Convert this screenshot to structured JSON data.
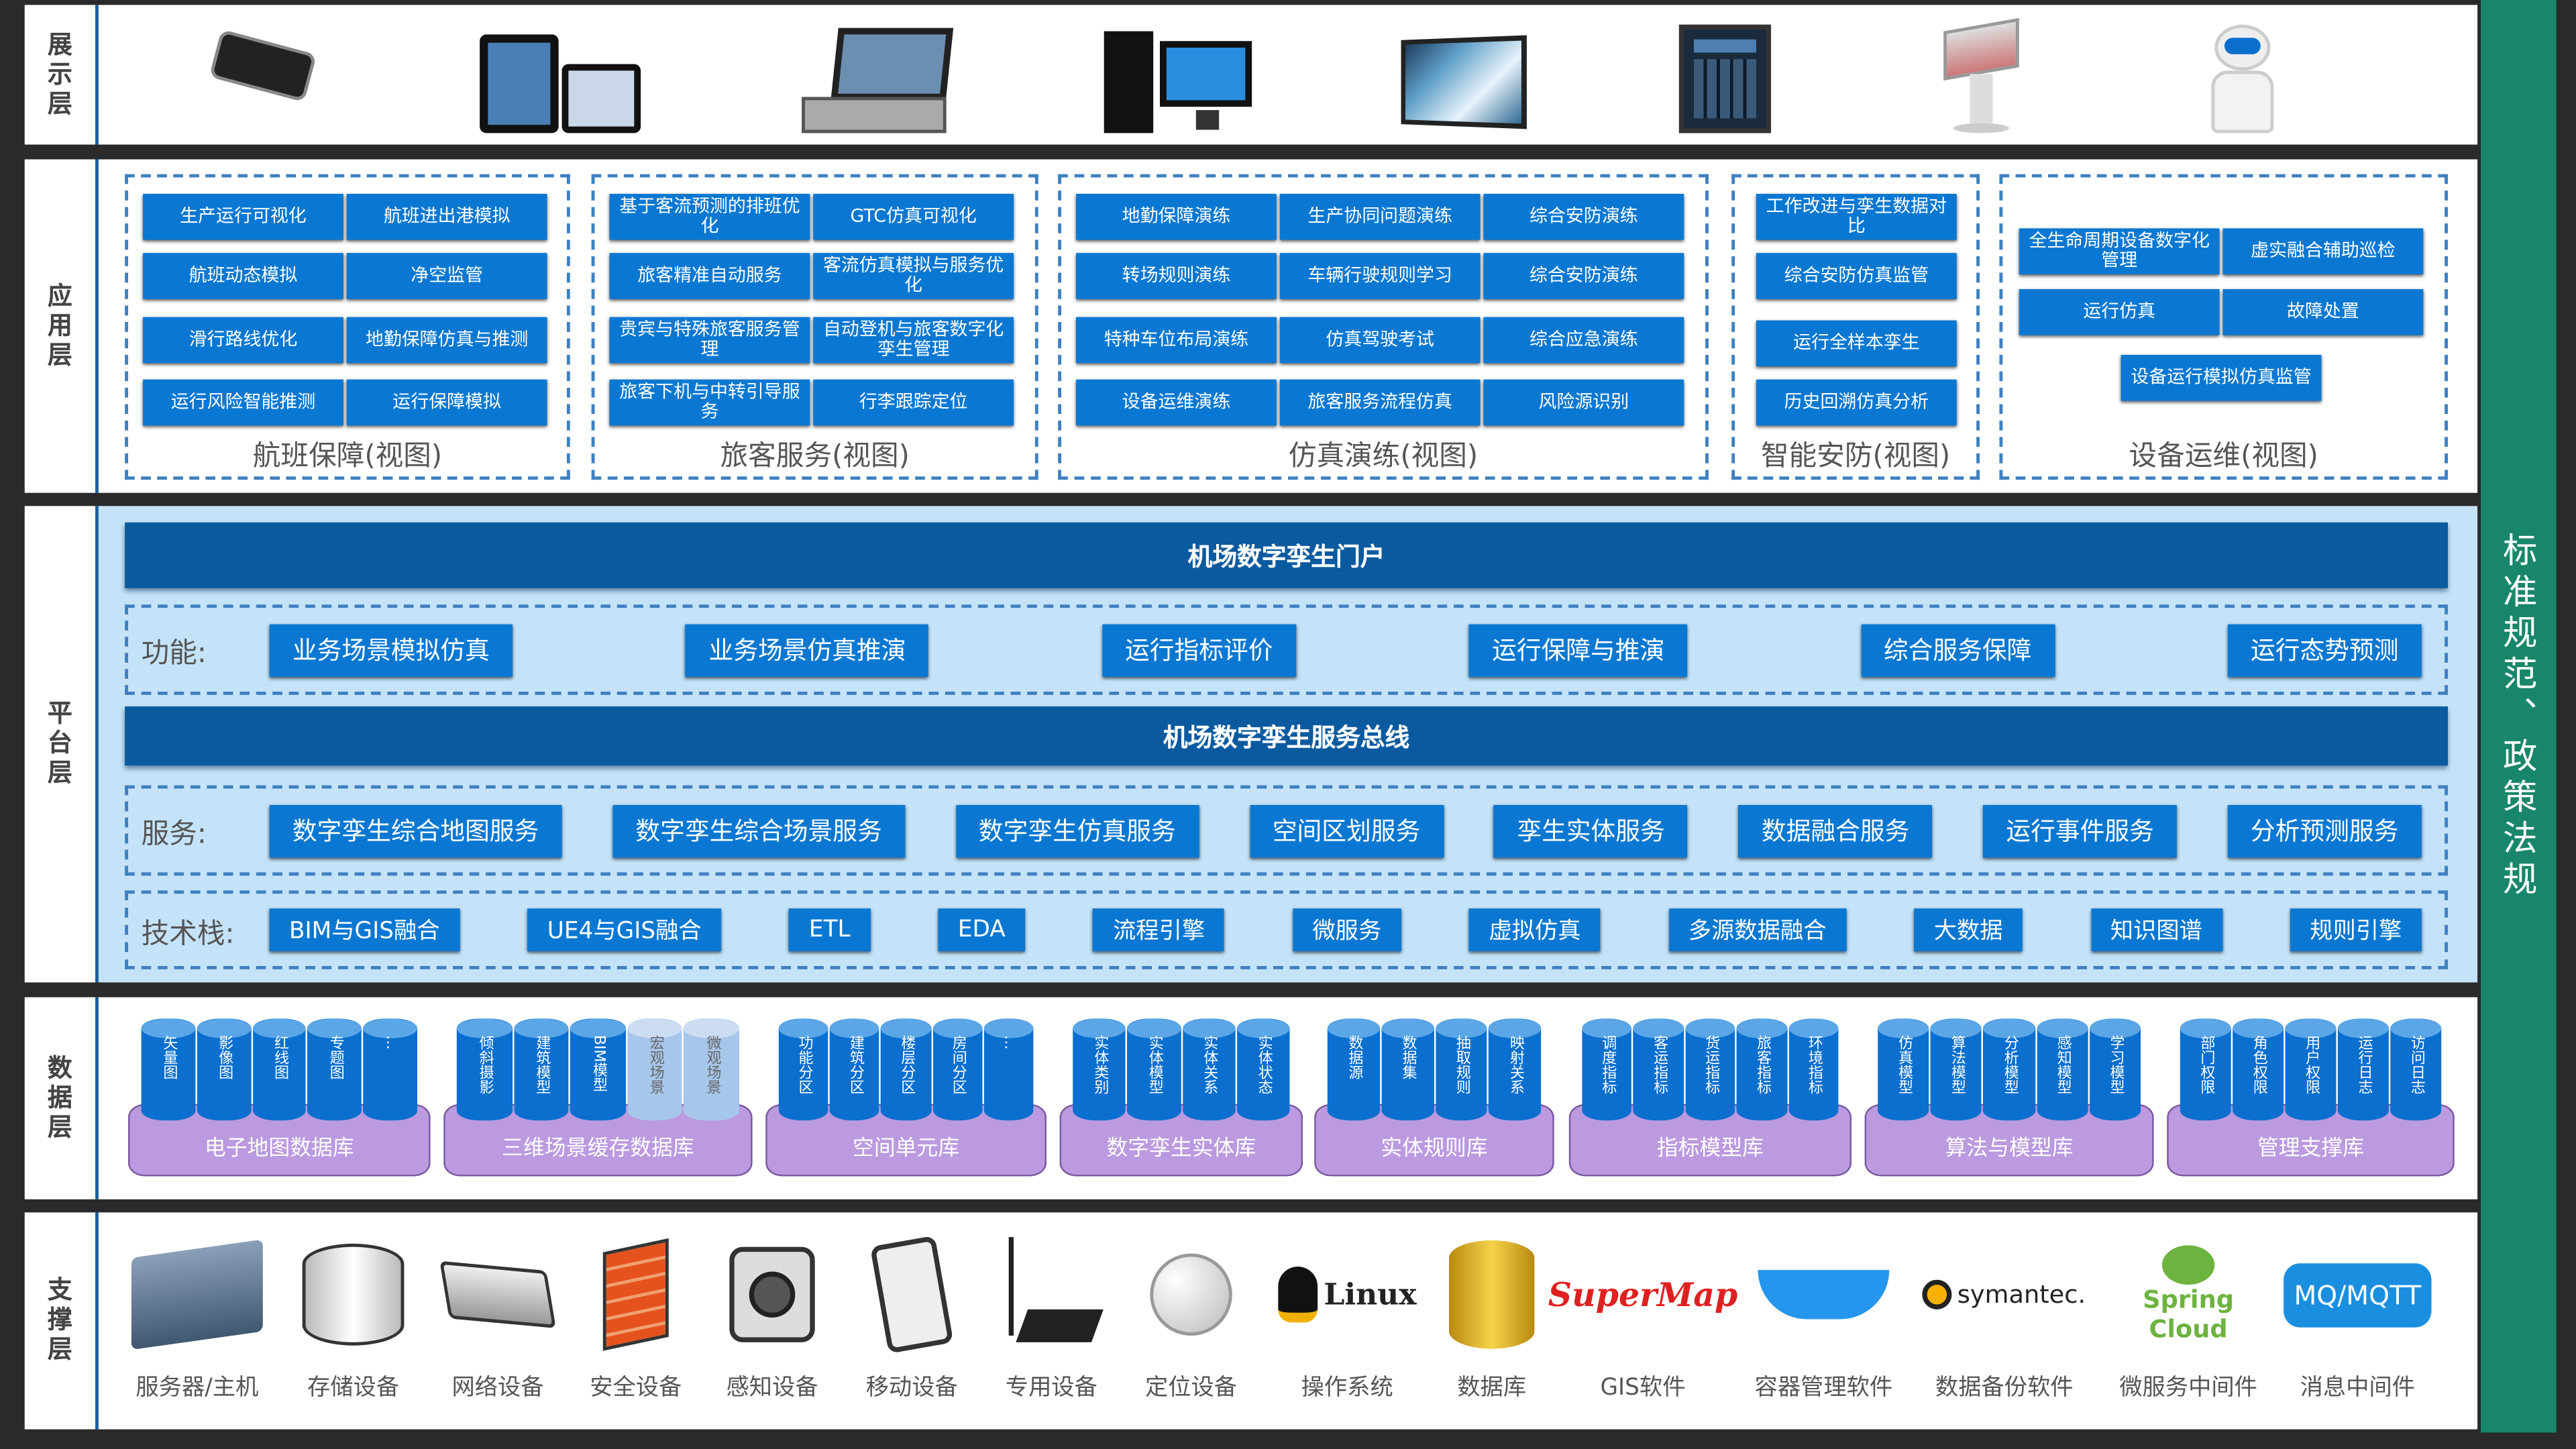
{
  "layers": {
    "display": "展示层",
    "application": "应用层",
    "platform": "平台层",
    "data": "数据层",
    "support": "支撑层"
  },
  "side_bar": "标准规范、政策法规",
  "display_devices": [
    "smartphone",
    "tablet",
    "vehicle-terminal",
    "desktop-computer",
    "video-wall",
    "kiosk-screen",
    "touch-kiosk",
    "service-robot"
  ],
  "app_groups": [
    {
      "title": "航班保障(视图)",
      "items": [
        "生产运行可视化",
        "航班进出港模拟",
        "航班动态模拟",
        "净空监管",
        "滑行路线优化",
        "地勤保障仿真与推测",
        "运行风险智能推测",
        "运行保障模拟"
      ]
    },
    {
      "title": "旅客服务(视图)",
      "items": [
        "基于客流预测的排班优化",
        "GTC仿真可视化",
        "旅客精准自动服务",
        "客流仿真模拟与服务优化",
        "贵宾与特殊旅客服务管理",
        "自动登机与旅客数字化孪生管理",
        "旅客下机与中转引导服务",
        "行李跟踪定位"
      ]
    },
    {
      "title": "仿真演练(视图)",
      "items": [
        "地勤保障演练",
        "生产协同问题演练",
        "综合安防演练",
        "转场规则演练",
        "车辆行驶规则学习",
        "综合安防演练",
        "特种车位布局演练",
        "仿真驾驶考试",
        "综合应急演练",
        "设备运维演练",
        "旅客服务流程仿真",
        "风险源识别"
      ]
    },
    {
      "title": "智能安防(视图)",
      "items": [
        "工作改进与孪生数据对比",
        "综合安防仿真监管",
        "运行全样本孪生",
        "历史回溯仿真分析"
      ]
    },
    {
      "title": "设备运维(视图)",
      "items": [
        "全生命周期设备数字化管理",
        "虚实融合辅助巡检",
        "运行仿真",
        "故障处置",
        "设备运行模拟仿真监管"
      ]
    }
  ],
  "platform": {
    "portal": "机场数字孪生门户",
    "bus": "机场数字孪生服务总线",
    "functions_label": "功能:",
    "functions": [
      "业务场景模拟仿真",
      "业务场景仿真推演",
      "运行指标评价",
      "运行保障与推演",
      "综合服务保障",
      "运行态势预测"
    ],
    "services_label": "服务:",
    "services": [
      "数字孪生综合地图服务",
      "数字孪生综合场景服务",
      "数字孪生仿真服务",
      "空间区划服务",
      "孪生实体服务",
      "数据融合服务",
      "运行事件服务",
      "分析预测服务"
    ],
    "tech_label": "技术栈:",
    "tech": [
      "BIM与GIS融合",
      "UE4与GIS融合",
      "ETL",
      "EDA",
      "流程引擎",
      "微服务",
      "虚拟仿真",
      "多源数据融合",
      "大数据",
      "知识图谱",
      "规则引擎"
    ]
  },
  "databases": [
    {
      "name": "电子地图数据库",
      "items": [
        "矢量图",
        "影像图",
        "红线图",
        "专题图",
        "…"
      ]
    },
    {
      "name": "三维场景缓存数据库",
      "items": [
        "倾斜摄影",
        "建筑模型",
        "BIM模型",
        "宏观场景",
        "微观场景"
      ]
    },
    {
      "name": "空间单元库",
      "items": [
        "功能分区",
        "建筑分区",
        "楼层分区",
        "房间分区",
        "…"
      ]
    },
    {
      "name": "数字孪生实体库",
      "items": [
        "实体类别",
        "实体模型",
        "实体关系",
        "实体状态"
      ]
    },
    {
      "name": "实体规则库",
      "items": [
        "数据源",
        "数据集",
        "抽取规则",
        "映射关系"
      ]
    },
    {
      "name": "指标模型库",
      "items": [
        "调度指标",
        "客运指标",
        "货运指标",
        "旅客指标",
        "环境指标"
      ]
    },
    {
      "name": "算法与模型库",
      "items": [
        "仿真模型",
        "算法模型",
        "分析模型",
        "感知模型",
        "学习模型"
      ]
    },
    {
      "name": "管理支撑库",
      "items": [
        "部门权限",
        "角色权限",
        "用户权限",
        "运行日志",
        "访问日志"
      ]
    }
  ],
  "support": [
    {
      "name": "服务器/主机",
      "icon": "server-icon"
    },
    {
      "name": "存储设备",
      "icon": "storage-icon"
    },
    {
      "name": "网络设备",
      "icon": "router-icon"
    },
    {
      "name": "安全设备",
      "icon": "firewall-icon"
    },
    {
      "name": "感知设备",
      "icon": "camera-icon"
    },
    {
      "name": "移动设备",
      "icon": "mobile-icon"
    },
    {
      "name": "专用设备",
      "icon": "special-device-icon"
    },
    {
      "name": "定位设备",
      "icon": "satellite-dish-icon"
    },
    {
      "name": "操作系统",
      "icon": "linux-logo",
      "logo": "Linux"
    },
    {
      "name": "数据库",
      "icon": "database-icon"
    },
    {
      "name": "GIS软件",
      "icon": "supermap-logo",
      "logo": "SuperMap"
    },
    {
      "name": "容器管理软件",
      "icon": "docker-logo"
    },
    {
      "name": "数据备份软件",
      "icon": "symantec-logo",
      "logo": "symantec."
    },
    {
      "name": "微服务中间件",
      "icon": "spring-cloud-logo",
      "logo": "Spring Cloud"
    },
    {
      "name": "消息中间件",
      "icon": "mq-logo",
      "logo": "MQ/MQTT"
    }
  ],
  "colors": {
    "button": "#0a78d2",
    "bar": "#0a5aa0",
    "platform_bg": "#c5e3f8",
    "db_base": "#bb9ae0",
    "side_bar": "#18866a"
  }
}
